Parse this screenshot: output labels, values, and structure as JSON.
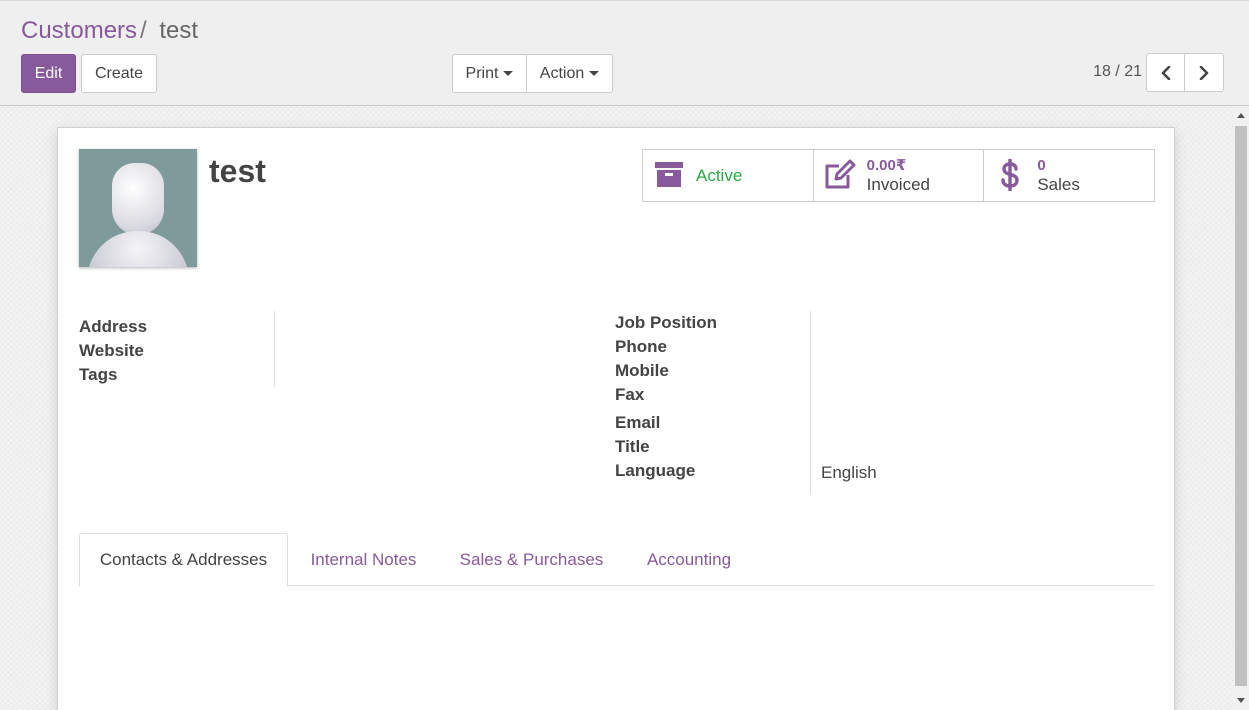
{
  "breadcrumb": {
    "parent": "Customers",
    "separator": "/",
    "current": "test"
  },
  "toolbar": {
    "edit_label": "Edit",
    "create_label": "Create",
    "print_label": "Print",
    "action_label": "Action"
  },
  "pager": {
    "value": "18 / 21"
  },
  "record": {
    "name": "test"
  },
  "stat_buttons": {
    "active": {
      "label": "Active"
    },
    "invoiced": {
      "value": "0.00₹",
      "label": "Invoiced"
    },
    "sales": {
      "value": "0",
      "label": "Sales"
    }
  },
  "fields_left": {
    "address": "Address",
    "website": "Website",
    "tags": "Tags"
  },
  "fields_right": {
    "job_position": "Job Position",
    "phone": "Phone",
    "mobile": "Mobile",
    "fax": "Fax",
    "email": "Email",
    "title": "Title",
    "language": "Language",
    "language_value": "English"
  },
  "tabs": [
    "Contacts & Addresses",
    "Internal Notes",
    "Sales & Purchases",
    "Accounting"
  ],
  "colors": {
    "brand": "#875a9b",
    "active": "#28a745"
  },
  "icons": {
    "active": "archive-icon",
    "invoiced": "edit-icon",
    "sales": "dollar-icon",
    "pager_prev": "chevron-left-icon",
    "pager_next": "chevron-right-icon"
  }
}
